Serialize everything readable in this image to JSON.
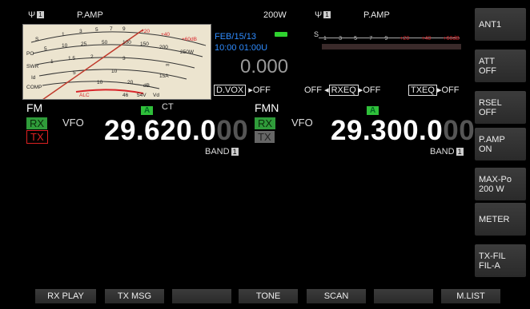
{
  "top": {
    "ant_num_left": "1",
    "pamp_left": "P.AMP",
    "power": "200W",
    "ant_num_right": "1",
    "pamp_right": "P.AMP"
  },
  "meter": {
    "scale_top": [
      "1",
      "3",
      "5",
      "7",
      "9",
      "+20",
      "+40",
      "+60dB"
    ],
    "scale_po": [
      "5",
      "10",
      "25",
      "50",
      "100",
      "150",
      "200",
      "250W"
    ],
    "scale_swr": [
      "1",
      "1.5",
      "2",
      "3",
      "∞"
    ],
    "scale_id": [
      "5",
      "10",
      "15A"
    ],
    "scale_comp": [
      "10",
      "20",
      "dB"
    ],
    "scale_vd": [
      "46",
      "54V",
      "Vd"
    ],
    "labels": [
      "S",
      "PO",
      "SWR",
      "Id",
      "COMP",
      "ALC"
    ],
    "alc_color": "#d9262b",
    "needle_color": "#c0392b"
  },
  "status": {
    "date": "FEB/15/13",
    "time": "10:00 01:00U",
    "offset": "0.000",
    "dvox_label": "D.VOX",
    "dvox_val": "OFF",
    "rxeq_prefix": "OFF",
    "rxeq_label": "RXEQ",
    "rxeq_val": "OFF",
    "txeq_label": "TXEQ",
    "txeq_val": "OFF"
  },
  "smeter_sub": {
    "label": "S",
    "ticks": [
      "1",
      "3",
      "5",
      "7",
      "9",
      "+20",
      "+40",
      "+60dB"
    ]
  },
  "main": {
    "mode": "FM",
    "rx": "RX",
    "tx": "TX",
    "vfo": "VFO",
    "a": "A",
    "ct": "CT",
    "freq_main": "29.620.0",
    "freq_dim": "00",
    "band": "BAND",
    "band_num": "1"
  },
  "sub": {
    "mode": "FMN",
    "rx": "RX",
    "tx": "TX",
    "vfo": "VFO",
    "a": "A",
    "freq_main": "29.300.0",
    "freq_dim": "00",
    "band": "BAND",
    "band_num": "1"
  },
  "right_keys": [
    {
      "l1": "ANT1",
      "l2": ""
    },
    {
      "l1": "ATT",
      "l2": "OFF"
    },
    {
      "l1": "RSEL",
      "l2": "OFF"
    },
    {
      "l1": "P.AMP",
      "l2": "ON"
    },
    {
      "l1": "MAX-Po",
      "l2": "200 W"
    },
    {
      "l1": "METER",
      "l2": ""
    },
    {
      "l1": "TX-FIL",
      "l2": "FIL-A"
    }
  ],
  "bottom_keys": [
    "RX PLAY",
    "TX MSG",
    "",
    "TONE",
    "SCAN",
    "",
    "M.LIST"
  ]
}
